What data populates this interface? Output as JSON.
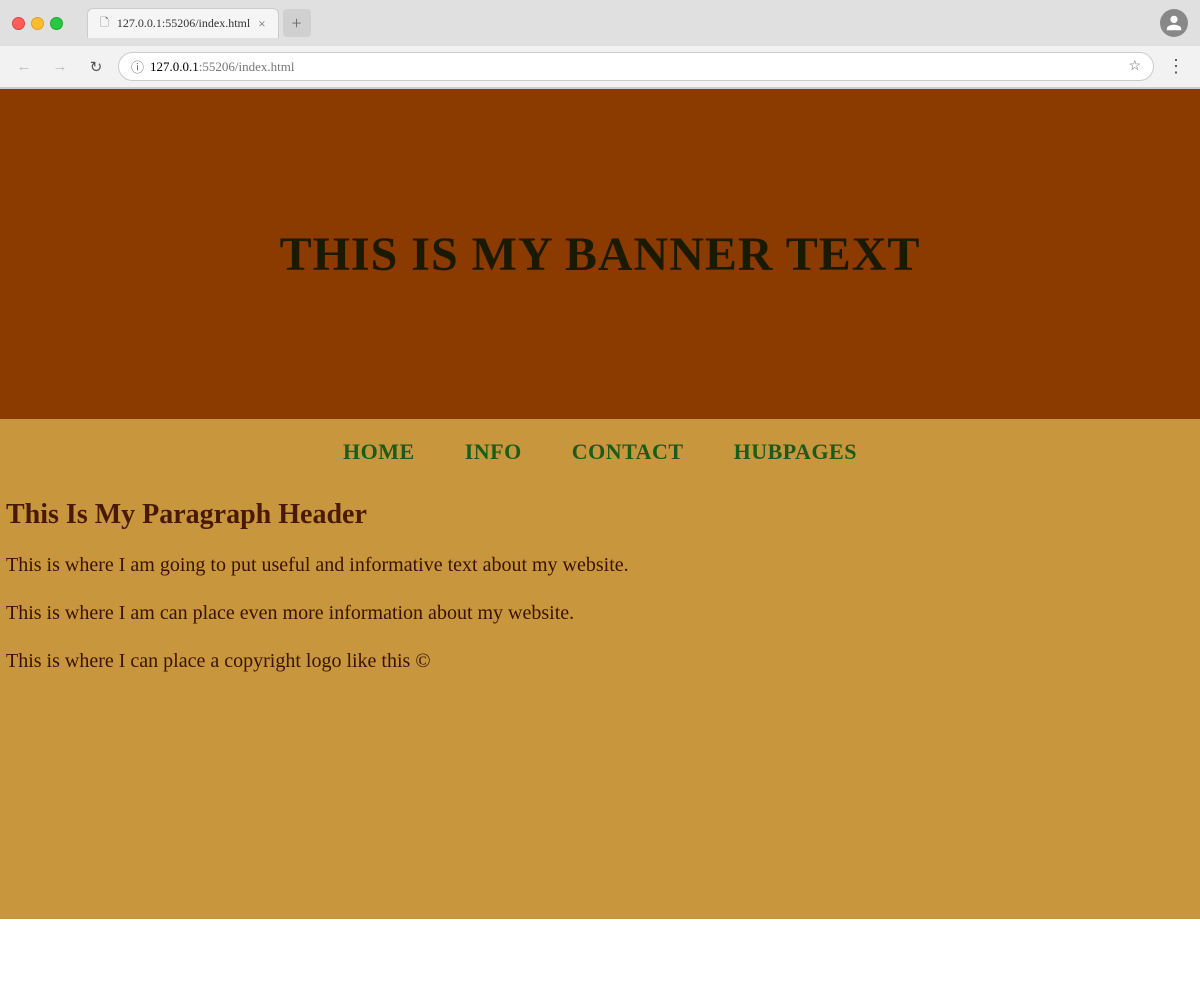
{
  "browser": {
    "tab_title": "127.0.0.1:55206/index.html",
    "url_bold": "127.0.0.1",
    "url_light": ":55206/index.html",
    "url_full": "127.0.0.1:55206/index.html",
    "new_tab_label": "+",
    "close_tab_label": "×",
    "back_label": "←",
    "forward_label": "→",
    "reload_label": "↻",
    "menu_label": "⋮"
  },
  "website": {
    "banner_text": "THIS IS MY BANNER TEXT",
    "nav": {
      "items": [
        {
          "label": "HOME",
          "href": "#"
        },
        {
          "label": "INFO",
          "href": "#"
        },
        {
          "label": "CONTACT",
          "href": "#"
        },
        {
          "label": "HUBPAGES",
          "href": "#"
        }
      ]
    },
    "paragraph_header": "This Is My Paragraph Header",
    "paragraph1": "This is where I am going to put useful and informative text about my website.",
    "paragraph2": "This is where I am can place even more information about my website.",
    "paragraph3": "This is where I can place a copyright logo like this ©"
  },
  "colors": {
    "banner_bg": "#8B3A00",
    "content_bg": "#c8963c",
    "nav_link": "#1a5c1a",
    "text_dark": "#3a1200",
    "header_color": "#4a1a00"
  }
}
